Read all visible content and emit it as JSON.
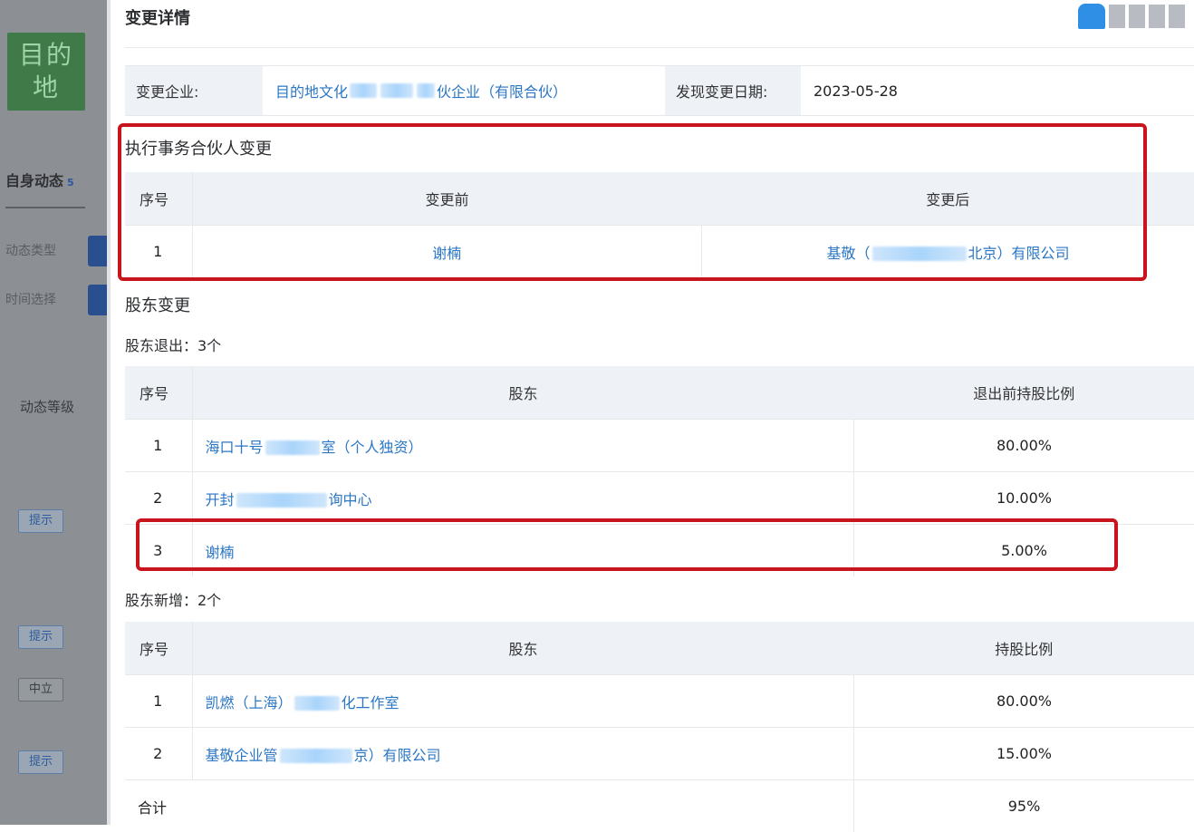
{
  "sidebar": {
    "logo_text": "目的地",
    "title": "自身动态",
    "title_badge": "5",
    "filters": [
      "动态类型",
      "时间选择"
    ],
    "level_label": "动态等级",
    "tags": [
      "提示",
      "提示",
      "中立",
      "提示"
    ]
  },
  "panel": {
    "title": "变更详情",
    "company_label": "变更企业:",
    "company_prefix": "目的地文化",
    "company_suffix": "伙企业（有限合伙）",
    "date_label": "发现变更日期:",
    "date_value": "2023-05-28"
  },
  "partner_change": {
    "title": "执行事务合伙人变更",
    "headers": [
      "序号",
      "变更前",
      "变更后"
    ],
    "row": {
      "idx": "1",
      "before": "谢楠",
      "after_prefix": "基敬（",
      "after_suffix": "北京）有限公司"
    }
  },
  "shareholder_change": {
    "title": "股东变更",
    "exit_title": "股东退出：3个",
    "exit_headers": [
      "序号",
      "股东",
      "退出前持股比例"
    ],
    "exits": [
      {
        "idx": "1",
        "name_prefix": "海口十号",
        "name_suffix": "室（个人独资）",
        "pct": "80.00%"
      },
      {
        "idx": "2",
        "name_prefix": "开封",
        "name_suffix": "询中心",
        "pct": "10.00%"
      },
      {
        "idx": "3",
        "name_prefix": "谢楠",
        "name_suffix": "",
        "pct": "5.00%"
      }
    ],
    "new_title": "股东新增：2个",
    "new_headers": [
      "序号",
      "股东",
      "持股比例"
    ],
    "news": [
      {
        "idx": "1",
        "name_prefix": "凯燃（上海）",
        "name_suffix": "化工作室",
        "pct": "80.00%"
      },
      {
        "idx": "2",
        "name_prefix": "基敬企业管",
        "name_suffix": "京）有限公司",
        "pct": "15.00%"
      }
    ],
    "total_label": "合计",
    "total_value": "95%"
  },
  "colors": {
    "accent_link": "#2b77c5",
    "highlight_red": "#c8141c",
    "header_bg": "#eef2f7"
  }
}
